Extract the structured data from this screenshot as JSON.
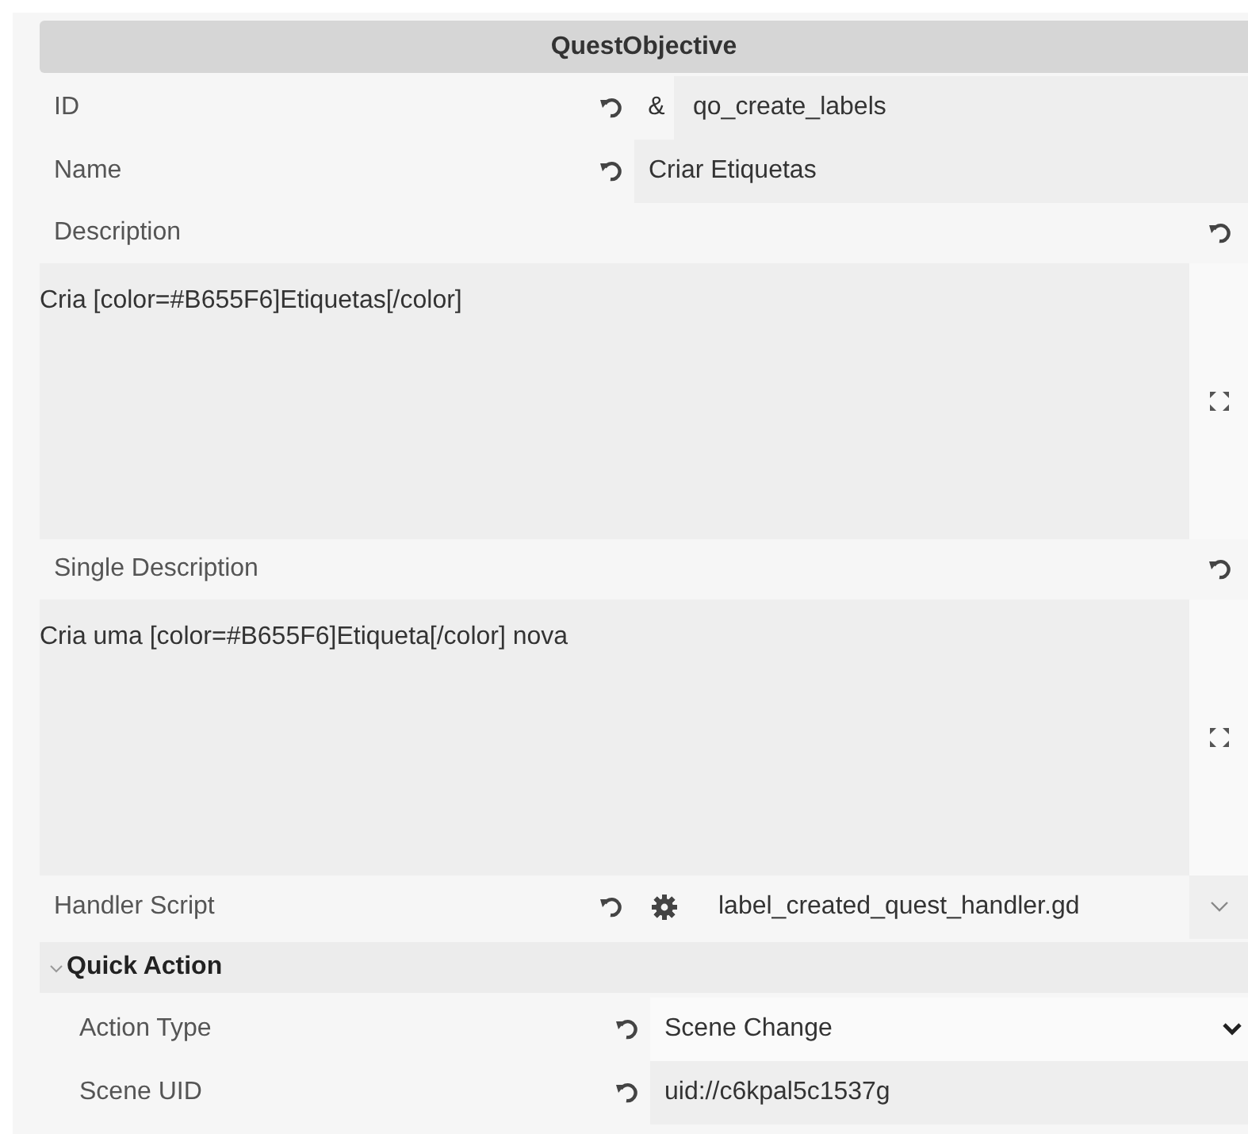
{
  "title": "QuestObjective",
  "properties": [
    {
      "kind": "text",
      "label": "ID",
      "prefix": "&",
      "value": "qo_create_labels"
    },
    {
      "kind": "text",
      "label": "Name",
      "value": "Criar Etiquetas"
    },
    {
      "kind": "multiline",
      "label": "Description",
      "value": "Cria [color=#B655F6]Etiquetas[/color]"
    },
    {
      "kind": "multiline",
      "label": "Single Description",
      "value": "Cria uma [color=#B655F6]Etiqueta[/color] nova"
    },
    {
      "kind": "resource",
      "label": "Handler Script",
      "value": "label_created_quest_handler.gd"
    }
  ],
  "groups": [
    {
      "title": "Quick Action",
      "expanded": true,
      "properties": [
        {
          "kind": "dropdown",
          "label": "Action Type",
          "value": "Scene Change"
        },
        {
          "kind": "text",
          "label": "Scene UID",
          "value": "uid://c6kpal5c1537g"
        }
      ]
    }
  ]
}
